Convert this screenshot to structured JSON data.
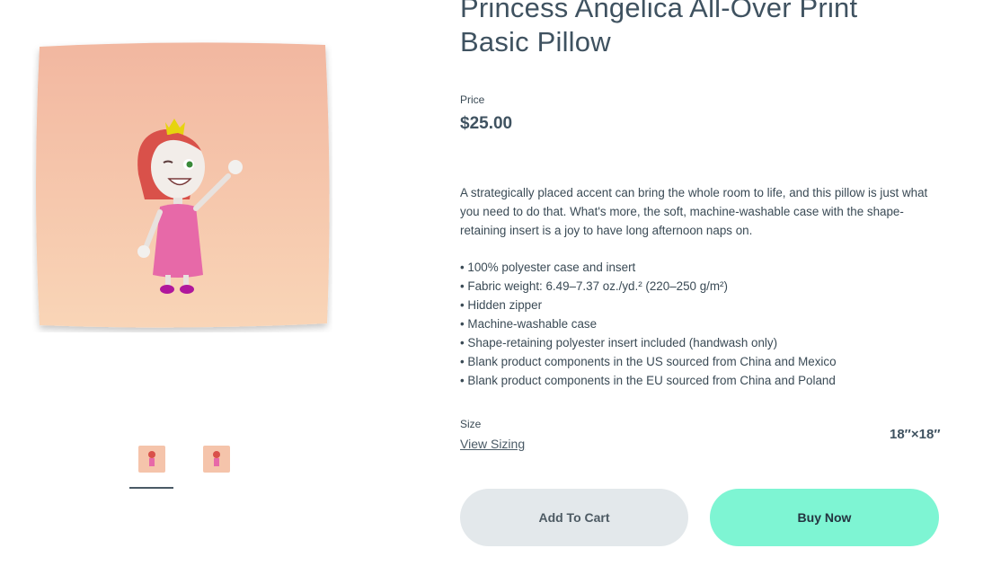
{
  "product": {
    "title": "Princess Angelica All-Over Print Basic Pillow",
    "price_label": "Price",
    "price": "$25.00",
    "description": "A strategically placed accent can bring the whole room to life, and this pillow is just what you need to do that. What's more, the soft, machine-washable case with the shape-retaining insert is a joy to have long afternoon naps on.",
    "features": [
      "• 100% polyester case and insert",
      "• Fabric weight: 6.49–7.37 oz./yd.² (220–250 g/m²)",
      "• Hidden zipper",
      "• Machine-washable case",
      "• Shape-retaining polyester insert included (handwash only)",
      "• Blank product components in the US sourced from China and Mexico",
      "• Blank product components in the EU sourced from China and Poland"
    ],
    "size_label": "Size",
    "view_sizing": "View Sizing",
    "size_value": "18″×18″"
  },
  "actions": {
    "add_to_cart": "Add To Cart",
    "buy_now": "Buy Now"
  },
  "gallery": {
    "thumbnail_count": 2,
    "active_thumbnail": 1
  },
  "colors": {
    "buy_now_bg": "#7ef5d3",
    "add_to_cart_bg": "#e3e8eb",
    "title_color": "#3f5260",
    "pillow_top": "#f2b9a2",
    "pillow_bottom": "#f9d6b8"
  }
}
